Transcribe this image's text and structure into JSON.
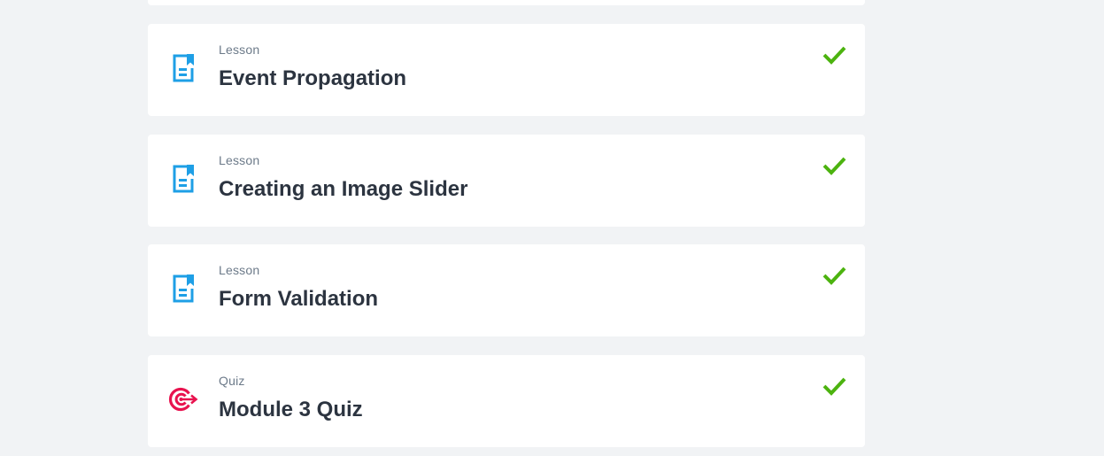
{
  "colors": {
    "background": "#f1f3f5",
    "card": "#ffffff",
    "lesson_icon": "#1e9fe6",
    "quiz_icon": "#e8124e",
    "check": "#4cb30f",
    "title": "#2c3440",
    "kind": "#6c7a89"
  },
  "items": [
    {
      "kind": "Lesson",
      "title": "Event Propagation",
      "icon": "lesson-document-icon",
      "completed": true
    },
    {
      "kind": "Lesson",
      "title": "Creating an Image Slider",
      "icon": "lesson-document-icon",
      "completed": true
    },
    {
      "kind": "Lesson",
      "title": "Form Validation",
      "icon": "lesson-document-icon",
      "completed": true
    },
    {
      "kind": "Quiz",
      "title": "Module 3 Quiz",
      "icon": "quiz-target-icon",
      "completed": true
    }
  ]
}
